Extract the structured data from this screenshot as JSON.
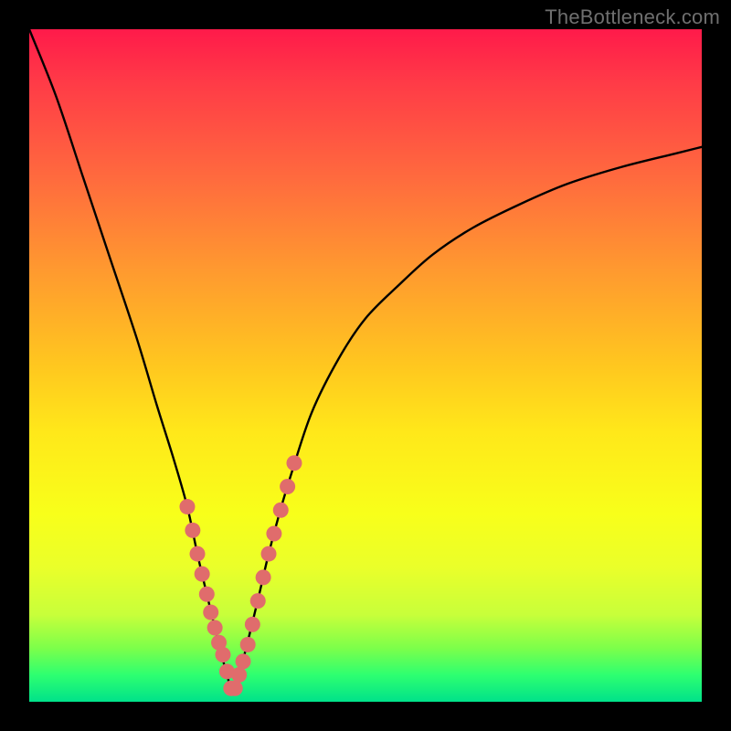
{
  "watermark": "TheBottleneck.com",
  "colors": {
    "background": "#000000",
    "curve_stroke": "#000000",
    "dot_fill": "#e06c6c",
    "dot_stroke": "#c95a5a"
  },
  "chart_data": {
    "type": "line",
    "title": "",
    "xlabel": "",
    "ylabel": "",
    "xlim": [
      0,
      100
    ],
    "ylim": [
      0,
      100
    ],
    "grid": false,
    "series": [
      {
        "name": "bottleneck-curve",
        "x": [
          0,
          4,
          8,
          12,
          16,
          19,
          21.5,
          23.5,
          25,
          26.4,
          27.6,
          28.6,
          29.4,
          30,
          30.6,
          31.2,
          32,
          33,
          34.2,
          35.6,
          37.2,
          39,
          42,
          46,
          50,
          55,
          60,
          66,
          73,
          80,
          88,
          96,
          100
        ],
        "y": [
          100,
          90,
          78,
          66,
          54,
          44,
          36,
          29,
          22,
          16,
          11,
          7,
          4,
          2,
          2,
          4,
          7,
          11,
          16,
          22,
          28,
          34,
          43,
          51,
          57,
          62,
          66.5,
          70.5,
          74,
          77,
          79.5,
          81.5,
          82.5
        ]
      }
    ],
    "highlight_points": {
      "name": "near-bottom-dots",
      "x": [
        23.5,
        24.3,
        25.0,
        25.7,
        26.4,
        27.0,
        27.6,
        28.2,
        28.8,
        29.4,
        30.0,
        30.6,
        31.2,
        31.8,
        32.5,
        33.2,
        34.0,
        34.8,
        35.6,
        36.4,
        37.4,
        38.4,
        39.4
      ],
      "y": [
        29.0,
        25.5,
        22.0,
        19.0,
        16.0,
        13.3,
        11.0,
        8.8,
        7.0,
        4.5,
        2.0,
        2.0,
        4.0,
        6.0,
        8.5,
        11.5,
        15.0,
        18.5,
        22.0,
        25.0,
        28.5,
        32.0,
        35.5
      ]
    }
  }
}
